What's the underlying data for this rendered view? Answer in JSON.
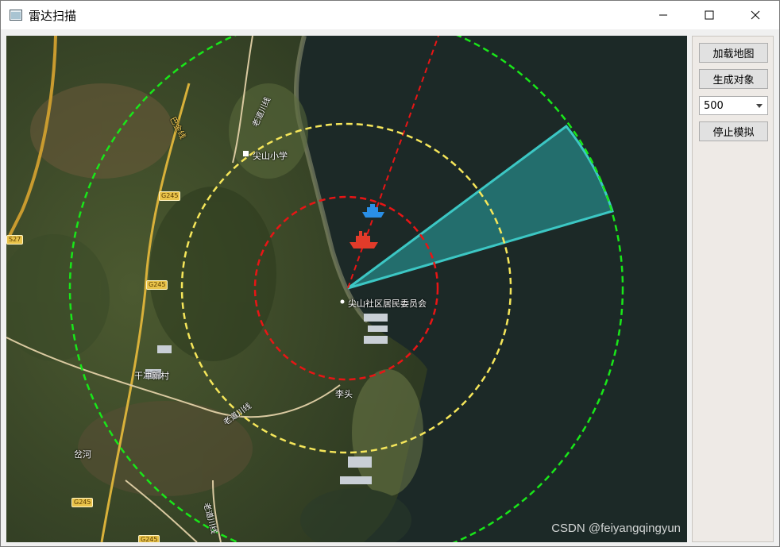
{
  "window": {
    "title": "雷达扫描",
    "controls": {
      "minimize": "minimize",
      "maximize": "maximize",
      "close": "close"
    }
  },
  "panel": {
    "load_map_label": "加载地图",
    "generate_objects_label": "生成对象",
    "count_select_value": "500",
    "stop_sim_label": "停止模拟"
  },
  "map": {
    "labels": {
      "school": "尖山小学",
      "committee": "尖山社区居民委员会",
      "village1": "干冲新村",
      "village2": "李头",
      "village3": "岔河",
      "road_laochuan_1": "老道川线",
      "road_laochuan_2": "老道川线",
      "road_laochuan_3": "老道川线",
      "road_bajin": "巴金线"
    },
    "road_badges": [
      "G245",
      "G245",
      "G245",
      "G245",
      "S27",
      "G245"
    ],
    "radar_colors": {
      "outer_ring": "#19e619",
      "middle_ring": "#f5e65a",
      "inner_ring": "#e81515",
      "bearing_line": "#e81515",
      "sweep_fill": "#2aa8a8"
    },
    "objects": [
      {
        "type": "ship-icon",
        "color": "#2a8fe6"
      },
      {
        "type": "ship-icon",
        "color": "#e23b2a"
      }
    ]
  },
  "watermark": "CSDN @feiyangqingyun"
}
